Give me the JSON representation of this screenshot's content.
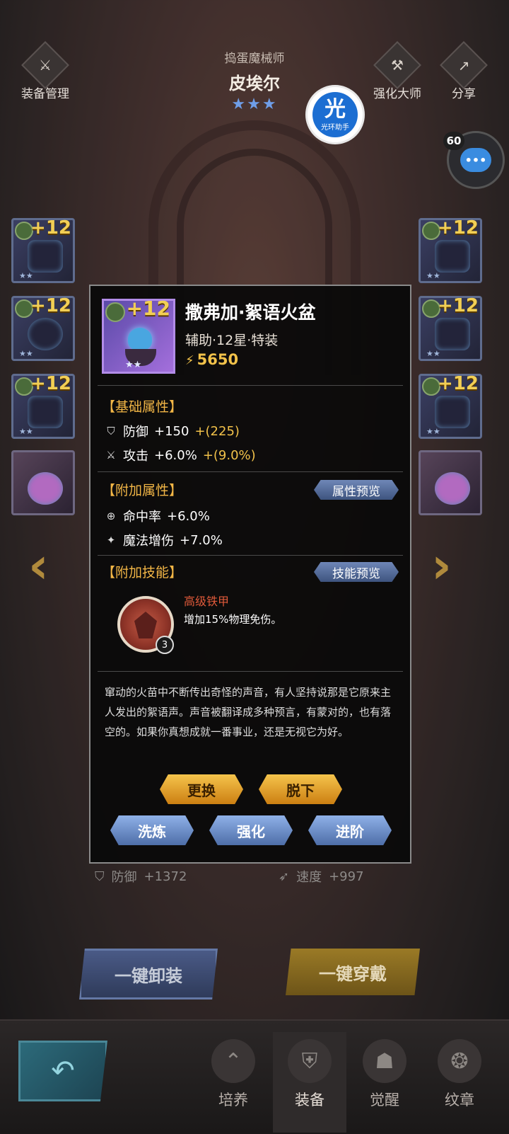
{
  "header": {
    "hero_subtitle": "捣蛋魔械师",
    "hero_name": "皮埃尔",
    "hero_stars": "★★★",
    "left_tool_label": "装备管理",
    "right_tool1_label": "强化大师",
    "right_tool2_label": "分享"
  },
  "halo": {
    "big": "光",
    "small": "光环助手"
  },
  "chat": {
    "level": "60",
    "icon": "chat-bubble-icon"
  },
  "slots": {
    "level_label": "+12"
  },
  "item": {
    "level": "+12",
    "name": "撒弗加·絮语火盆",
    "meta": "辅助·12星·特装",
    "power": "5650",
    "stars": "★★"
  },
  "base_attrs": {
    "title": "【基础属性】",
    "rows": [
      {
        "label": "防御",
        "value": "+150",
        "bonus": "+(225)",
        "icon": "shield-icon"
      },
      {
        "label": "攻击",
        "value": "+6.0%",
        "bonus": "+(9.0%)",
        "icon": "swords-icon"
      }
    ]
  },
  "extra_attrs": {
    "title": "【附加属性】",
    "preview": "属性预览",
    "rows": [
      {
        "label": "命中率",
        "value": "+6.0%",
        "icon": "crosshair-icon"
      },
      {
        "label": "魔法增伤",
        "value": "+7.0%",
        "icon": "magic-wand-icon"
      }
    ]
  },
  "extra_skill": {
    "title": "【附加技能】",
    "preview": "技能预览",
    "name": "高级铁甲",
    "desc": "增加15%物理免伤。",
    "level": "3"
  },
  "lore": "窜动的火苗中不断传出奇怪的声音，有人坚持说那是它原来主人发出的絮语声。声音被翻译成多种预言，有蒙对的，也有落空的。如果你真想成就一番事业，还是无视它为好。",
  "buttons": {
    "replace": "更换",
    "remove": "脱下",
    "refine": "洗炼",
    "enhance": "强化",
    "advance": "进阶",
    "refine_alert": "!"
  },
  "hero_stats": [
    {
      "label": "防御",
      "value": "+1372"
    },
    {
      "label": "速度",
      "value": "+997"
    }
  ],
  "bulk": {
    "unequip": "一键卸装",
    "equip": "一键穿戴"
  },
  "nav": {
    "back": "↶",
    "items": [
      {
        "label": "培养"
      },
      {
        "label": "装备"
      },
      {
        "label": "觉醒"
      },
      {
        "label": "纹章"
      }
    ]
  }
}
